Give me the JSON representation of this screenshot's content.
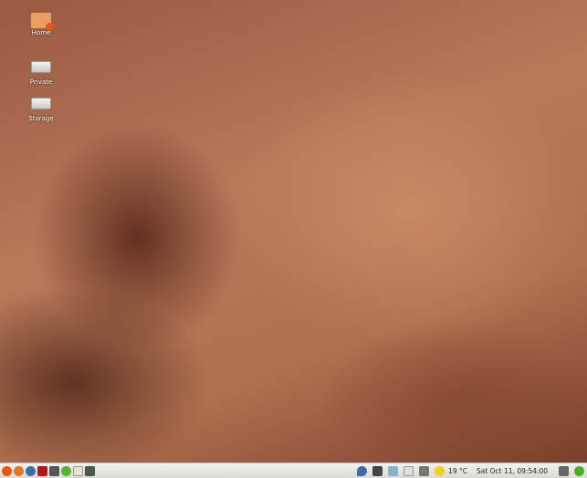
{
  "desktop": {
    "icons": [
      {
        "label": "Home",
        "icon": "home-folder-icon"
      },
      {
        "label": "Private",
        "icon": "drive-icon"
      },
      {
        "label": "Storage",
        "icon": "drive-icon"
      }
    ]
  },
  "panel": {
    "launchers": [
      "ubuntu-menu-icon",
      "firefox-icon",
      "thunderbird-icon",
      "filezilla-icon",
      "terminal-icon",
      "media-player-icon",
      "text-editor-icon",
      "calculator-icon"
    ],
    "weather": "19 °C",
    "clock": "Sat Oct 11, 09:54:00",
    "colors": {
      "ubuntu": "#e05a10",
      "firefox": "#e07a20",
      "thunderbird": "#3a6ea8",
      "filezilla": "#b01818",
      "media": "#5bb030",
      "status": "#4caf20"
    }
  }
}
